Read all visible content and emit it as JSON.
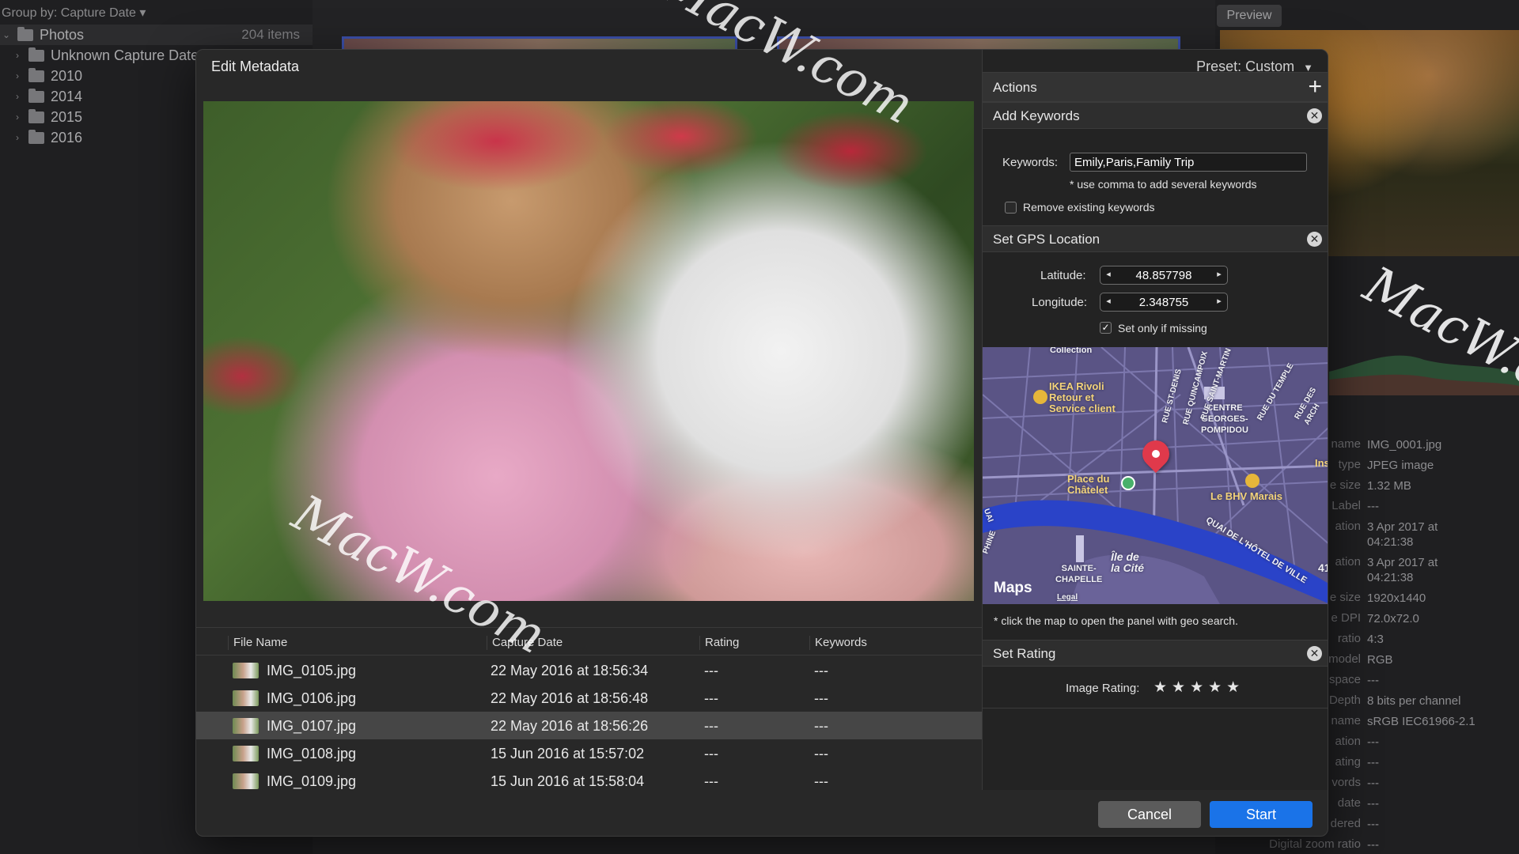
{
  "background": {
    "group_by": "Group by: Capture Date ▾",
    "tree": [
      {
        "label": "Photos",
        "count": "204 items",
        "root": true
      },
      {
        "label": "Unknown Capture Date"
      },
      {
        "label": "2010"
      },
      {
        "label": "2014"
      },
      {
        "label": "2015"
      },
      {
        "label": "2016"
      }
    ],
    "preview_label": "Preview",
    "info": [
      {
        "k": "name",
        "v": "IMG_0001.jpg"
      },
      {
        "k": "type",
        "v": "JPEG image"
      },
      {
        "k": "e size",
        "v": "1.32 MB"
      },
      {
        "k": "Label",
        "v": "---"
      },
      {
        "k": "ation",
        "v": "3 Apr 2017 at\n04:21:38"
      },
      {
        "k": "ation",
        "v": "3 Apr 2017 at\n04:21:38"
      },
      {
        "k": "e size",
        "v": "1920x1440"
      },
      {
        "k": "e DPI",
        "v": "72.0x72.0"
      },
      {
        "k": "ratio",
        "v": "4:3"
      },
      {
        "k": "model",
        "v": "RGB"
      },
      {
        "k": "space",
        "v": "---"
      },
      {
        "k": "Depth",
        "v": "8 bits per channel"
      },
      {
        "k": "name",
        "v": "sRGB IEC61966-2.1"
      },
      {
        "k": "ation",
        "v": "---"
      },
      {
        "k": "ating",
        "v": "---"
      },
      {
        "k": "vords",
        "v": "---"
      },
      {
        "k": "date",
        "v": "---"
      },
      {
        "k": "dered",
        "v": "---"
      },
      {
        "k": "Digital zoom ratio",
        "v": "---"
      }
    ]
  },
  "dialog": {
    "title": "Edit Metadata",
    "table": {
      "headers": [
        "File Name",
        "Capture Date",
        "Rating",
        "Keywords"
      ],
      "rows": [
        {
          "name": "IMG_0105.jpg",
          "date": "22 May 2016 at 18:56:34",
          "rating": "---",
          "keywords": "---"
        },
        {
          "name": "IMG_0106.jpg",
          "date": "22 May 2016 at 18:56:48",
          "rating": "---",
          "keywords": "---"
        },
        {
          "name": "IMG_0107.jpg",
          "date": "22 May 2016 at 18:56:26",
          "rating": "---",
          "keywords": "---",
          "selected": true
        },
        {
          "name": "IMG_0108.jpg",
          "date": "15 Jun 2016 at 15:57:02",
          "rating": "---",
          "keywords": "---"
        },
        {
          "name": "IMG_0109.jpg",
          "date": "15 Jun 2016 at 15:58:04",
          "rating": "---",
          "keywords": "---"
        }
      ]
    },
    "panel": {
      "preset": "Preset: Custom",
      "actions_label": "Actions",
      "add_keywords": {
        "title": "Add Keywords",
        "keywords_label": "Keywords:",
        "keywords_value": "Emily,Paris,Family Trip",
        "hint": "* use comma to add several keywords",
        "remove_label": "Remove existing keywords",
        "remove_checked": false
      },
      "gps": {
        "title": "Set GPS Location",
        "latitude_label": "Latitude:",
        "latitude": "48.857798",
        "longitude_label": "Longitude:",
        "longitude": "2.348755",
        "only_missing_label": "Set only if missing",
        "only_missing_checked": true,
        "map_labels": {
          "collection": "Collection",
          "ikea": "IKEA Rivoli\nRetour et\nService client",
          "centre": "CENTRE\nGEORGES-\nPOMPIDOU",
          "chatelet": "Place du\nChâtelet",
          "bhv": "Le BHV Marais",
          "chapelle": "SAINTE-\nCHAPELLE",
          "ile": "Île de\nla Cité",
          "ins": "Ins",
          "num": "41",
          "rue_st_denis": "RUE ST-DENIS",
          "quincampoix": "RUE QUINCAMPOIX",
          "saint_martin": "RUE SAINT-MARTIN",
          "du_temple": "RUE DU TEMPLE",
          "des_arch": "RUE DES ARCH",
          "quai": "QUAI DE L'HÔTEL DE VILLE",
          "uai": "UAI",
          "phine": "PHINE",
          "maps": "Maps",
          "legal": "Legal"
        },
        "map_hint": "* click the map to open the panel with geo search."
      },
      "rating": {
        "title": "Set Rating",
        "label": "Image Rating:",
        "stars_filled": 0,
        "stars_total": 5,
        "stars_text": "★★★★★"
      }
    },
    "cancel_label": "Cancel",
    "start_label": "Start"
  },
  "watermarks": [
    "MacW.com",
    "MacW.com",
    "MacW.c"
  ],
  "colors": {
    "accent": "#1a73e8",
    "selected_row": "#464646",
    "map_bg": "#5a5485",
    "pin": "#e0394b"
  }
}
